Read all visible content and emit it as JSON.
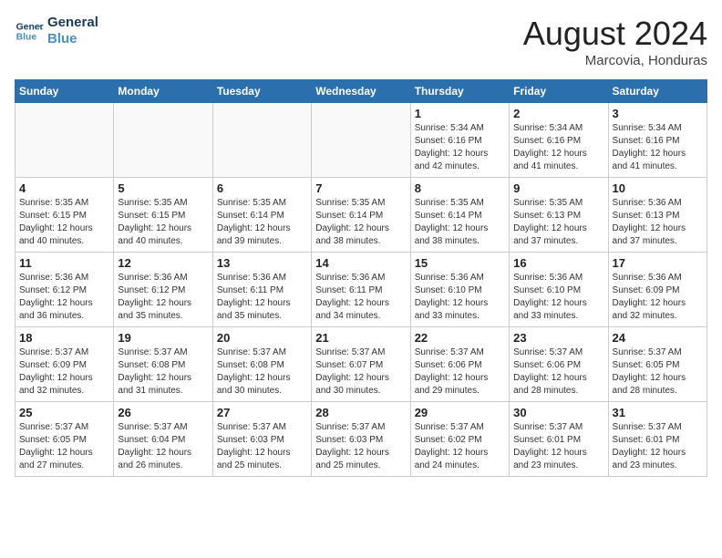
{
  "logo": {
    "line1": "General",
    "line2": "Blue"
  },
  "title": "August 2024",
  "location": "Marcovia, Honduras",
  "days_of_week": [
    "Sunday",
    "Monday",
    "Tuesday",
    "Wednesday",
    "Thursday",
    "Friday",
    "Saturday"
  ],
  "weeks": [
    [
      {
        "day": "",
        "info": ""
      },
      {
        "day": "",
        "info": ""
      },
      {
        "day": "",
        "info": ""
      },
      {
        "day": "",
        "info": ""
      },
      {
        "day": "1",
        "info": "Sunrise: 5:34 AM\nSunset: 6:16 PM\nDaylight: 12 hours\nand 42 minutes."
      },
      {
        "day": "2",
        "info": "Sunrise: 5:34 AM\nSunset: 6:16 PM\nDaylight: 12 hours\nand 41 minutes."
      },
      {
        "day": "3",
        "info": "Sunrise: 5:34 AM\nSunset: 6:16 PM\nDaylight: 12 hours\nand 41 minutes."
      }
    ],
    [
      {
        "day": "4",
        "info": "Sunrise: 5:35 AM\nSunset: 6:15 PM\nDaylight: 12 hours\nand 40 minutes."
      },
      {
        "day": "5",
        "info": "Sunrise: 5:35 AM\nSunset: 6:15 PM\nDaylight: 12 hours\nand 40 minutes."
      },
      {
        "day": "6",
        "info": "Sunrise: 5:35 AM\nSunset: 6:14 PM\nDaylight: 12 hours\nand 39 minutes."
      },
      {
        "day": "7",
        "info": "Sunrise: 5:35 AM\nSunset: 6:14 PM\nDaylight: 12 hours\nand 38 minutes."
      },
      {
        "day": "8",
        "info": "Sunrise: 5:35 AM\nSunset: 6:14 PM\nDaylight: 12 hours\nand 38 minutes."
      },
      {
        "day": "9",
        "info": "Sunrise: 5:35 AM\nSunset: 6:13 PM\nDaylight: 12 hours\nand 37 minutes."
      },
      {
        "day": "10",
        "info": "Sunrise: 5:36 AM\nSunset: 6:13 PM\nDaylight: 12 hours\nand 37 minutes."
      }
    ],
    [
      {
        "day": "11",
        "info": "Sunrise: 5:36 AM\nSunset: 6:12 PM\nDaylight: 12 hours\nand 36 minutes."
      },
      {
        "day": "12",
        "info": "Sunrise: 5:36 AM\nSunset: 6:12 PM\nDaylight: 12 hours\nand 35 minutes."
      },
      {
        "day": "13",
        "info": "Sunrise: 5:36 AM\nSunset: 6:11 PM\nDaylight: 12 hours\nand 35 minutes."
      },
      {
        "day": "14",
        "info": "Sunrise: 5:36 AM\nSunset: 6:11 PM\nDaylight: 12 hours\nand 34 minutes."
      },
      {
        "day": "15",
        "info": "Sunrise: 5:36 AM\nSunset: 6:10 PM\nDaylight: 12 hours\nand 33 minutes."
      },
      {
        "day": "16",
        "info": "Sunrise: 5:36 AM\nSunset: 6:10 PM\nDaylight: 12 hours\nand 33 minutes."
      },
      {
        "day": "17",
        "info": "Sunrise: 5:36 AM\nSunset: 6:09 PM\nDaylight: 12 hours\nand 32 minutes."
      }
    ],
    [
      {
        "day": "18",
        "info": "Sunrise: 5:37 AM\nSunset: 6:09 PM\nDaylight: 12 hours\nand 32 minutes."
      },
      {
        "day": "19",
        "info": "Sunrise: 5:37 AM\nSunset: 6:08 PM\nDaylight: 12 hours\nand 31 minutes."
      },
      {
        "day": "20",
        "info": "Sunrise: 5:37 AM\nSunset: 6:08 PM\nDaylight: 12 hours\nand 30 minutes."
      },
      {
        "day": "21",
        "info": "Sunrise: 5:37 AM\nSunset: 6:07 PM\nDaylight: 12 hours\nand 30 minutes."
      },
      {
        "day": "22",
        "info": "Sunrise: 5:37 AM\nSunset: 6:06 PM\nDaylight: 12 hours\nand 29 minutes."
      },
      {
        "day": "23",
        "info": "Sunrise: 5:37 AM\nSunset: 6:06 PM\nDaylight: 12 hours\nand 28 minutes."
      },
      {
        "day": "24",
        "info": "Sunrise: 5:37 AM\nSunset: 6:05 PM\nDaylight: 12 hours\nand 28 minutes."
      }
    ],
    [
      {
        "day": "25",
        "info": "Sunrise: 5:37 AM\nSunset: 6:05 PM\nDaylight: 12 hours\nand 27 minutes."
      },
      {
        "day": "26",
        "info": "Sunrise: 5:37 AM\nSunset: 6:04 PM\nDaylight: 12 hours\nand 26 minutes."
      },
      {
        "day": "27",
        "info": "Sunrise: 5:37 AM\nSunset: 6:03 PM\nDaylight: 12 hours\nand 25 minutes."
      },
      {
        "day": "28",
        "info": "Sunrise: 5:37 AM\nSunset: 6:03 PM\nDaylight: 12 hours\nand 25 minutes."
      },
      {
        "day": "29",
        "info": "Sunrise: 5:37 AM\nSunset: 6:02 PM\nDaylight: 12 hours\nand 24 minutes."
      },
      {
        "day": "30",
        "info": "Sunrise: 5:37 AM\nSunset: 6:01 PM\nDaylight: 12 hours\nand 23 minutes."
      },
      {
        "day": "31",
        "info": "Sunrise: 5:37 AM\nSunset: 6:01 PM\nDaylight: 12 hours\nand 23 minutes."
      }
    ]
  ]
}
